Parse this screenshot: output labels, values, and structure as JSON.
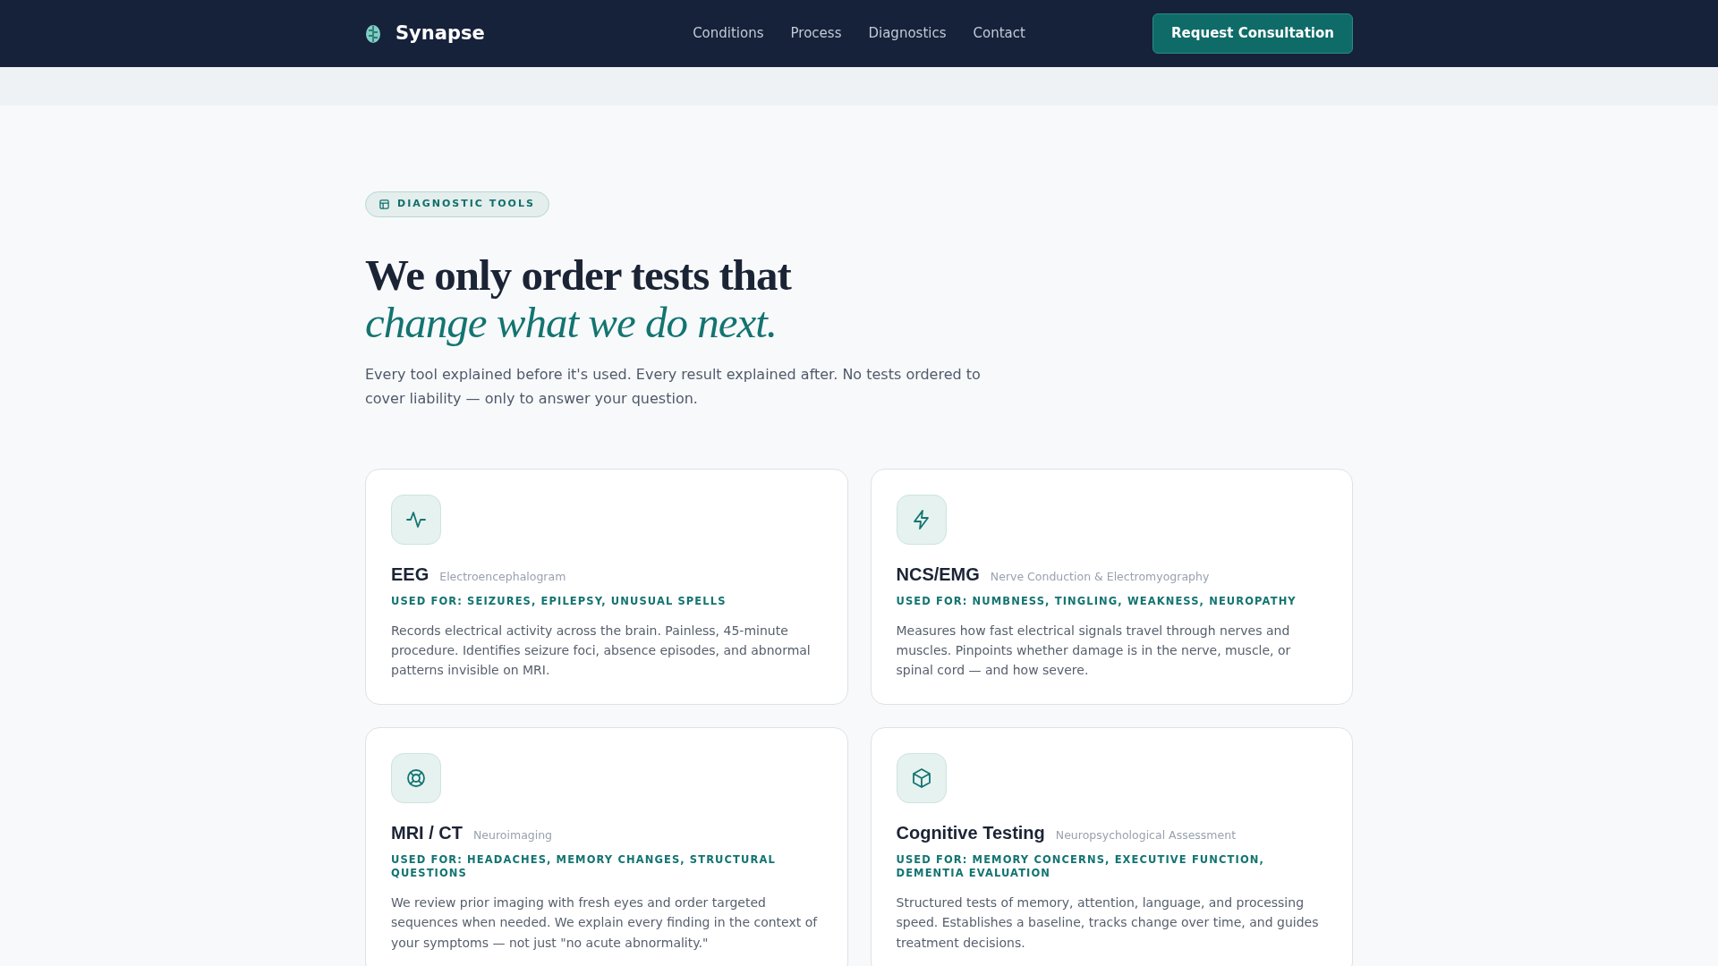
{
  "navbar": {
    "brand": "Synapse",
    "links": [
      "Conditions",
      "Process",
      "Diagnostics",
      "Contact"
    ],
    "cta": "Request Consultation"
  },
  "hero": {
    "badge": "DIAGNOSTIC TOOLS",
    "title": "We only order tests that",
    "title_accent": "change what we do next.",
    "lead": "Every tool explained before it's used. Every result explained after. No tests ordered to cover liability — only to answer your question."
  },
  "tools": [
    {
      "name": "EEG",
      "subtitle": "Electroencephalogram",
      "used_for": "USED FOR: SEIZURES, EPILEPSY, UNUSUAL SPELLS",
      "description": "Records electrical activity across the brain. Painless, 45-minute procedure. Identifies seizure foci, absence episodes, and abnormal patterns invisible on MRI."
    },
    {
      "name": "NCS/EMG",
      "subtitle": "Nerve Conduction & Electromyography",
      "used_for": "USED FOR: NUMBNESS, TINGLING, WEAKNESS, NEUROPATHY",
      "description": "Measures how fast electrical signals travel through nerves and muscles. Pinpoints whether damage is in the nerve, muscle, or spinal cord — and how severe."
    },
    {
      "name": "MRI / CT",
      "subtitle": "Neuroimaging",
      "used_for": "USED FOR: HEADACHES, MEMORY CHANGES, STRUCTURAL QUESTIONS",
      "description": "We review prior imaging with fresh eyes and order targeted sequences when needed. We explain every finding in the context of your symptoms — not just \"no acute abnormality.\""
    },
    {
      "name": "Cognitive Testing",
      "subtitle": "Neuropsychological Assessment",
      "used_for": "USED FOR: MEMORY CONCERNS, EXECUTIVE FUNCTION, DEMENTIA EVALUATION",
      "description": "Structured tests of memory, attention, language, and processing speed. Establishes a baseline, tracks change over time, and guides treatment decisions."
    }
  ]
}
